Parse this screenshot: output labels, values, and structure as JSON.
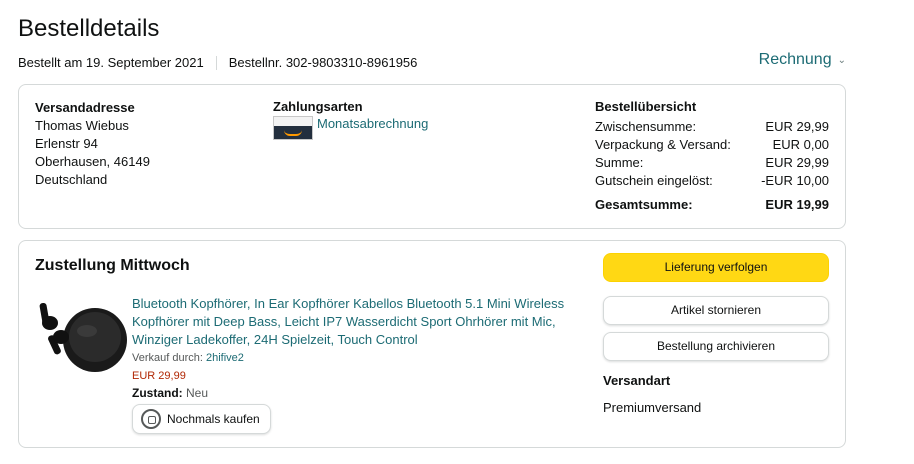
{
  "page": {
    "title": "Bestelldetails",
    "ordered_on": "Bestellt am 19. September 2021",
    "order_number": "Bestellnr. 302-9803310-8961956",
    "invoice_label": "Rechnung"
  },
  "shipping_address": {
    "heading": "Versandadresse",
    "name": "Thomas Wiebus",
    "street": "Erlenstr 94",
    "city": "Oberhausen, 46149",
    "country": "Deutschland"
  },
  "payment": {
    "heading": "Zahlungsarten",
    "method": "Monatsabrechnung",
    "icon": "amazon-card-icon"
  },
  "summary": {
    "heading": "Bestellübersicht",
    "rows": [
      {
        "label": "Zwischensumme:",
        "value": "EUR 29,99"
      },
      {
        "label": "Verpackung & Versand:",
        "value": "EUR 0,00"
      },
      {
        "label": "Summe:",
        "value": "EUR 29,99"
      },
      {
        "label": "Gutschein eingelöst:",
        "value": "-EUR 10,00"
      }
    ],
    "total_label": "Gesamtsumme:",
    "total_value": "EUR 19,99"
  },
  "delivery": {
    "heading": "Zustellung Mittwoch",
    "product_title": "Bluetooth Kopfhörer, In Ear Kopfhörer Kabellos Bluetooth 5.1 Mini Wireless Kopfhörer mit Deep Bass, Leicht IP7 Wasserdicht Sport Ohrhörer mit Mic, Winziger Ladekoffer, 24H Spielzeit, Touch Control",
    "seller_prefix": "Verkauf durch: ",
    "seller_name": "2hifive2",
    "price": "EUR 29,99",
    "condition_label": "Zustand:",
    "condition_value": "Neu",
    "rebuy_label": "Nochmals kaufen",
    "buttons": {
      "track": "Lieferung verfolgen",
      "cancel": "Artikel stornieren",
      "archive": "Bestellung archivieren"
    },
    "shipping_type_heading": "Versandart",
    "shipping_type_value": "Premiumversand"
  },
  "colors": {
    "link": "#1c6b74",
    "price": "#b12704",
    "primary_button": "#ffd814",
    "border": "#d5d9d9"
  }
}
